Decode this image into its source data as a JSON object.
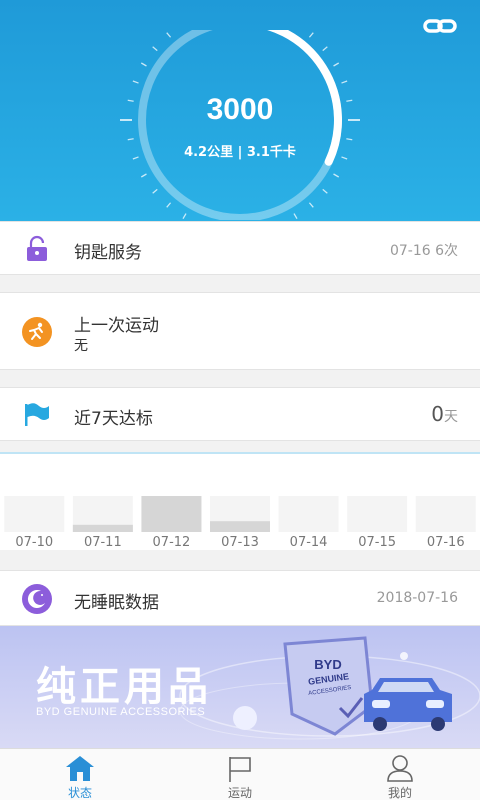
{
  "header": {
    "steps": "3000",
    "summary": "4.2公里 | 3.1千卡",
    "progress": 0.32,
    "link_icon": "link-icon"
  },
  "key_service": {
    "title": "钥匙服务",
    "right": "07-16 6次",
    "icon": "lock-icon",
    "color": "#8c5ddb"
  },
  "last_exercise": {
    "title": "上一次运动",
    "value": "无",
    "icon": "runner-icon",
    "color": "#f39322"
  },
  "weekly_goal": {
    "title": "近7天达标",
    "count": "0",
    "unit": "天",
    "icon": "flag-icon",
    "color": "#27a8e0"
  },
  "chart_data": {
    "type": "bar",
    "categories": [
      "07-10",
      "07-11",
      "07-12",
      "07-13",
      "07-14",
      "07-15",
      "07-16"
    ],
    "values": [
      0,
      600,
      3000,
      900,
      0,
      0,
      0
    ],
    "ylim": [
      0,
      3000
    ],
    "grid": false
  },
  "sleep": {
    "title": "无睡眠数据",
    "date": "2018-07-16",
    "icon": "moon-icon",
    "color": "#8c5ddb"
  },
  "banner": {
    "title": "纯正用品",
    "subtitle": "BYD GENUINE ACCESSORIES",
    "badge_line1": "BYD",
    "badge_line2": "GENUINE",
    "badge_line3": "ACCESSORIES"
  },
  "tabs": [
    {
      "label": "状态",
      "icon": "home-icon",
      "active": true
    },
    {
      "label": "运动",
      "icon": "flag-outline-icon",
      "active": false
    },
    {
      "label": "我的",
      "icon": "user-icon",
      "active": false
    }
  ],
  "colors": {
    "accent": "#2a8fd6",
    "header": "#1f9ad8"
  }
}
